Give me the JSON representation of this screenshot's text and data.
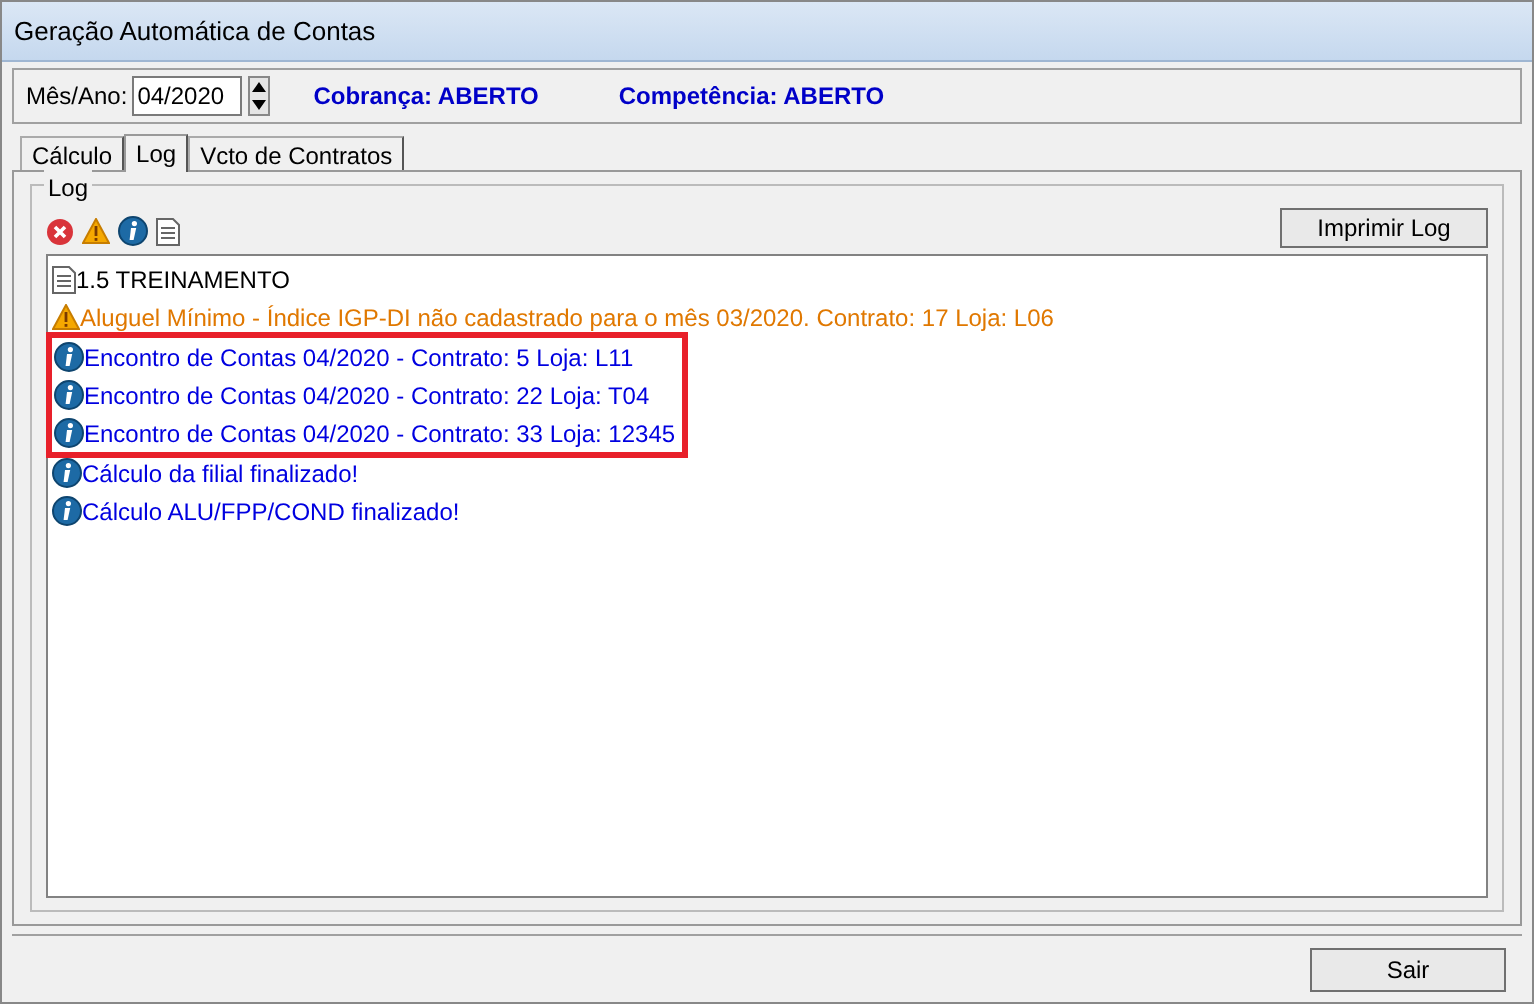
{
  "window": {
    "title": "Geração Automática de Contas"
  },
  "period": {
    "label": "Mês/Ano:",
    "value": "04/2020"
  },
  "status": [
    "Cobrança: ABERTO",
    "Competência: ABERTO"
  ],
  "tabs": [
    {
      "label": "Cálculo",
      "selected": false
    },
    {
      "label": "Log",
      "selected": true
    },
    {
      "label": "Vcto de Contratos",
      "selected": false
    }
  ],
  "log_group": {
    "title": "Log",
    "print_button": "Imprimir Log",
    "entries": [
      {
        "kind": "document",
        "text": "1.5 TREINAMENTO",
        "highlighted": false
      },
      {
        "kind": "warning",
        "text": "Aluguel Mínimo - Índice IGP-DI não cadastrado para o mês 03/2020. Contrato: 17 Loja: L06",
        "highlighted": false
      },
      {
        "kind": "info",
        "text": "Encontro de Contas 04/2020 - Contrato: 5 Loja: L11",
        "highlighted": true
      },
      {
        "kind": "info",
        "text": "Encontro de Contas 04/2020 - Contrato: 22 Loja: T04",
        "highlighted": true
      },
      {
        "kind": "info",
        "text": "Encontro de Contas 04/2020 - Contrato: 33 Loja: 12345",
        "highlighted": true
      },
      {
        "kind": "info",
        "text": "Cálculo da filial finalizado!",
        "highlighted": false
      },
      {
        "kind": "info",
        "text": "Cálculo ALU/FPP/COND finalizado!",
        "highlighted": false
      }
    ]
  },
  "exit_button": "Sair"
}
